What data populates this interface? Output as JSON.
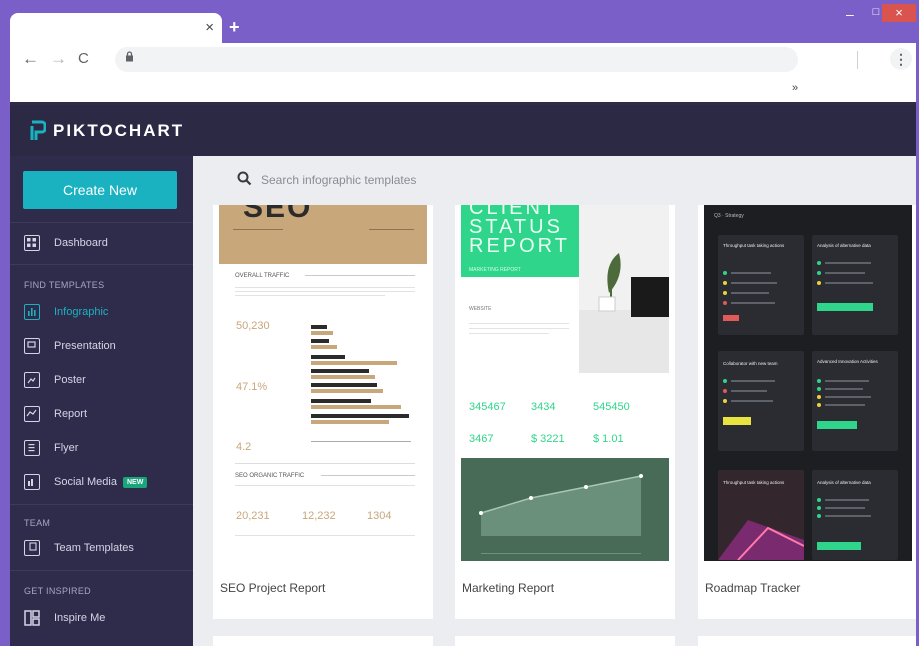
{
  "browser": {
    "new_tab_symbol": "+",
    "tab_close_symbol": "×",
    "back_symbol": "←",
    "forward_symbol": "→",
    "reload_symbol": "C",
    "lock_symbol": "🔒",
    "menu_symbol": "⋮",
    "bookmarks_overflow": "»",
    "window_min": "–",
    "window_max": "□",
    "window_close": "×"
  },
  "app": {
    "logo_text": "PIKTOCHART",
    "brand_color": "#1ab2c1"
  },
  "sidebar": {
    "create_label": "Create New",
    "dashboard_label": "Dashboard",
    "find_section": "FIND TEMPLATES",
    "items": [
      {
        "label": "Infographic",
        "icon": "bar-chart-icon",
        "active": true
      },
      {
        "label": "Presentation",
        "icon": "presentation-icon"
      },
      {
        "label": "Poster",
        "icon": "poster-icon"
      },
      {
        "label": "Report",
        "icon": "report-icon"
      },
      {
        "label": "Flyer",
        "icon": "flyer-icon"
      },
      {
        "label": "Social Media",
        "icon": "social-media-icon",
        "badge": "NEW"
      }
    ],
    "team_section": "TEAM",
    "team_templates_label": "Team Templates",
    "inspired_section": "GET INSPIRED",
    "inspire_label": "Inspire Me"
  },
  "search": {
    "placeholder": "Search infographic templates"
  },
  "templates": [
    {
      "title": "SEO Project Report",
      "thumb": {
        "heading": "SEO",
        "section1": "OVERALL TRAFFIC",
        "stat1": "50,230",
        "stat2": "47.1%",
        "stat3": "4.2",
        "section2": "SEO ORGANIC TRAFFIC",
        "stat4": "20,231",
        "stat5": "12,232",
        "stat6": "1304"
      }
    },
    {
      "title": "Marketing Report",
      "thumb": {
        "line1": "CLIENT",
        "line2": "STATUS",
        "line3": "REPORT",
        "subtitle": "MARKETING REPORT",
        "website": "WEBSITE",
        "n1": "345467",
        "n2": "3434",
        "n3": "545450",
        "n4": "3467",
        "n5": "$ 3221",
        "n6": "$ 1.01"
      }
    },
    {
      "title": "Roadmap Tracker",
      "thumb": {
        "header": "Q3 · Strategy",
        "panel1": "Throughput task taking actions",
        "panel2": "Analysis of alternative data",
        "panel3": "Collaborator with new team",
        "panel4": "Advanced Innovation Activities",
        "panel5": "Throughput task taking actions",
        "panel6": "Analysis of alternative data"
      }
    }
  ]
}
